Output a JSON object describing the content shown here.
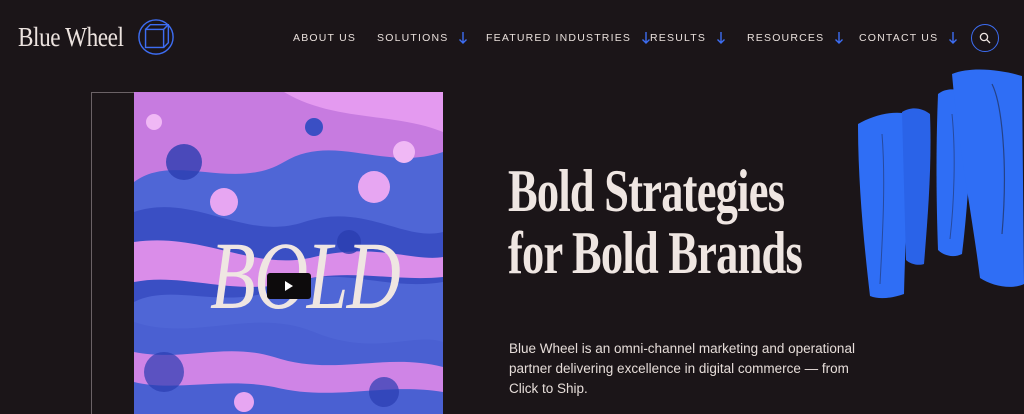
{
  "brand": {
    "name": "Blue Wheel",
    "logo_icon": "cube-wheel-icon",
    "accent": "#3d6df2"
  },
  "nav": {
    "items": [
      {
        "label": "ABOUT US",
        "has_dropdown": false
      },
      {
        "label": "SOLUTIONS",
        "has_dropdown": true
      },
      {
        "label": "FEATURED INDUSTRIES",
        "has_dropdown": true
      },
      {
        "label": "RESULTS",
        "has_dropdown": true
      },
      {
        "label": "RESOURCES",
        "has_dropdown": true
      },
      {
        "label": "CONTACT US",
        "has_dropdown": true
      }
    ],
    "dropdown_icon": "arrow-down-icon",
    "search_icon": "search-icon"
  },
  "hero": {
    "video": {
      "overlay_word": "BOLD",
      "play_icon": "play-icon"
    },
    "headline": {
      "line1": "Bold Strategies",
      "line2": "for Bold Brands"
    },
    "description": "Blue Wheel is an omni-channel marketing and operational partner delivering excellence in digital commerce — from Click to Ship."
  },
  "colors": {
    "background": "#1b1518",
    "text": "#efe6e2",
    "accent_blue": "#2f6ef5",
    "art_pink": "#d98ce8"
  }
}
